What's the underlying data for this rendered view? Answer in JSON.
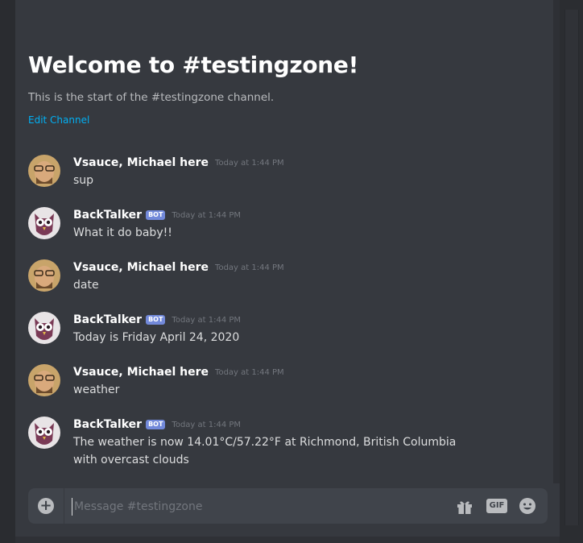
{
  "channel": {
    "welcome_title": "Welcome to #testingzone!",
    "welcome_sub": "This is the start of the #testingzone channel.",
    "edit_label": "Edit Channel"
  },
  "messages": [
    {
      "author": "Vsauce, Michael here",
      "bot": false,
      "time": "Today at 1:44 PM",
      "text": "sup",
      "avatar": "person-avatar"
    },
    {
      "author": "BackTalker",
      "bot": true,
      "bot_label": "BOT",
      "time": "Today at 1:44 PM",
      "text": "What it do baby!!",
      "avatar": "owl-avatar"
    },
    {
      "author": "Vsauce, Michael here",
      "bot": false,
      "time": "Today at 1:44 PM",
      "text": "date",
      "avatar": "person-avatar"
    },
    {
      "author": "BackTalker",
      "bot": true,
      "bot_label": "BOT",
      "time": "Today at 1:44 PM",
      "text": "Today is Friday April 24, 2020",
      "avatar": "owl-avatar"
    },
    {
      "author": "Vsauce, Michael here",
      "bot": false,
      "time": "Today at 1:44 PM",
      "text": "weather",
      "avatar": "person-avatar"
    },
    {
      "author": "BackTalker",
      "bot": true,
      "bot_label": "BOT",
      "time": "Today at 1:44 PM",
      "text": "The weather is now 14.01°C/57.22°F at Richmond, British Columbia with overcast clouds",
      "avatar": "owl-avatar"
    }
  ],
  "composer": {
    "placeholder": "Message #testingzone",
    "gif_label": "GIF",
    "plus_icon": "+"
  },
  "colors": {
    "background": "#36393f",
    "bot_badge": "#7289da",
    "link": "#00b0f4"
  }
}
